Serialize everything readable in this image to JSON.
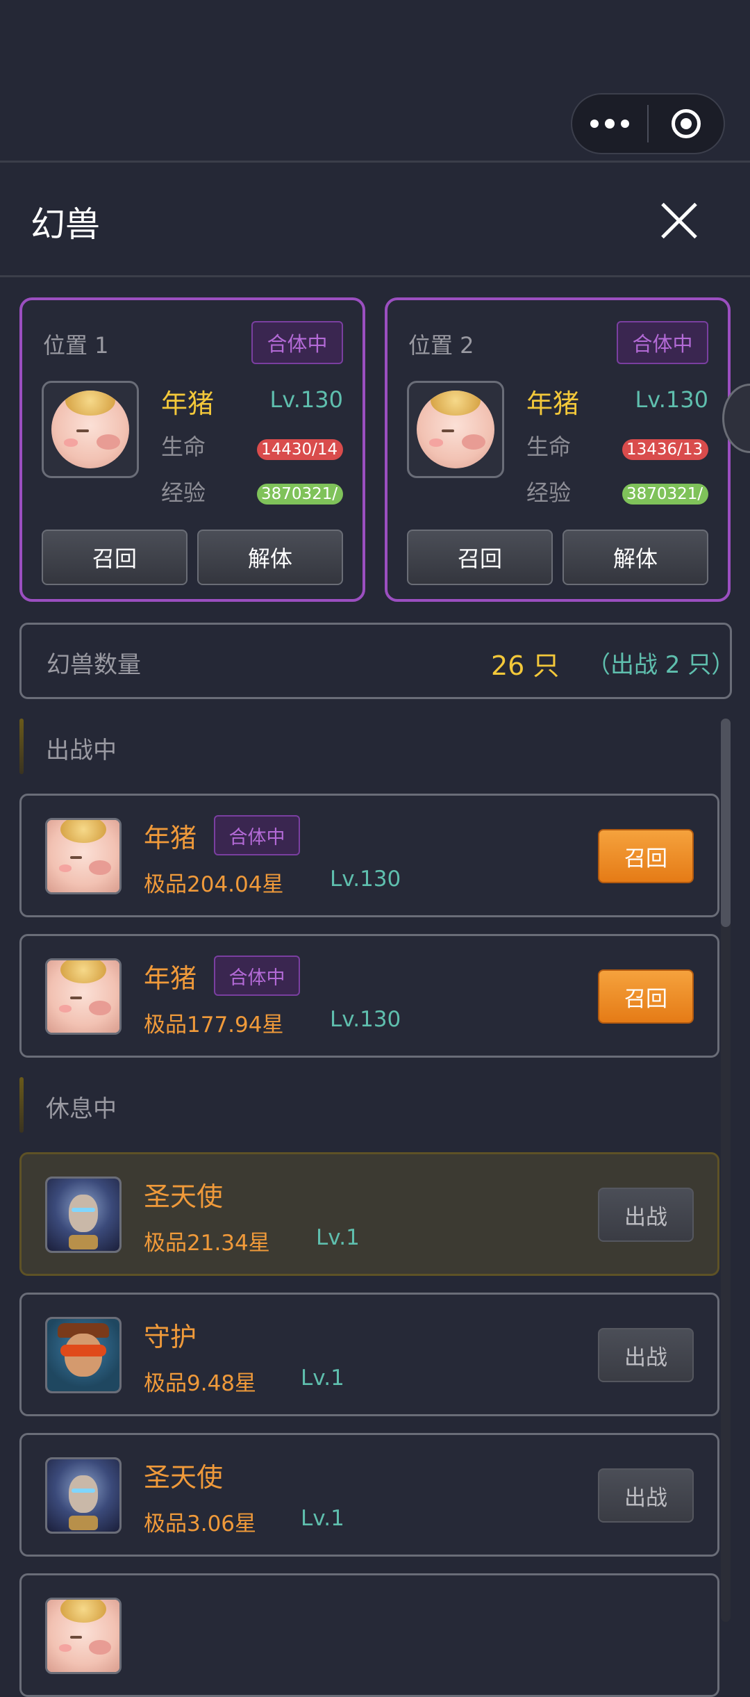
{
  "capsule": {
    "more_icon": "more-dots-icon",
    "target_icon": "target-icon"
  },
  "header": {
    "title": "幻兽"
  },
  "slots": [
    {
      "label": "位置 1",
      "badge": "合体中",
      "name": "年猪",
      "level": "Lv.130",
      "hp_label": "生命",
      "hp_value": "14430/14",
      "exp_label": "经验",
      "exp_value": "3870321/",
      "recall": "召回",
      "dismiss": "解体"
    },
    {
      "label": "位置 2",
      "badge": "合体中",
      "name": "年猪",
      "level": "Lv.130",
      "hp_label": "生命",
      "hp_value": "13436/13",
      "exp_label": "经验",
      "exp_value": "3870321/",
      "recall": "召回",
      "dismiss": "解体"
    }
  ],
  "count": {
    "label": "幻兽数量",
    "value": "26 只",
    "battle": "（出战 2 只）"
  },
  "sections": {
    "active": "出战中",
    "resting": "休息中"
  },
  "active_list": [
    {
      "name": "年猪",
      "badge": "合体中",
      "quality": "极品204.04星",
      "level": "Lv.130",
      "action": "召回"
    },
    {
      "name": "年猪",
      "badge": "合体中",
      "quality": "极品177.94星",
      "level": "Lv.130",
      "action": "召回"
    }
  ],
  "resting_list": [
    {
      "name": "圣天使",
      "quality": "极品21.34星",
      "level": "Lv.1",
      "action": "出战"
    },
    {
      "name": "守护",
      "quality": "极品9.48星",
      "level": "Lv.1",
      "action": "出战"
    },
    {
      "name": "圣天使",
      "quality": "极品3.06星",
      "level": "Lv.1",
      "action": "出战"
    }
  ],
  "colors": {
    "background": "#252836",
    "slot_border": "#9b4fc0",
    "gold": "#f3c83a",
    "teal": "#5fbfae",
    "orange": "#f09a3a"
  }
}
